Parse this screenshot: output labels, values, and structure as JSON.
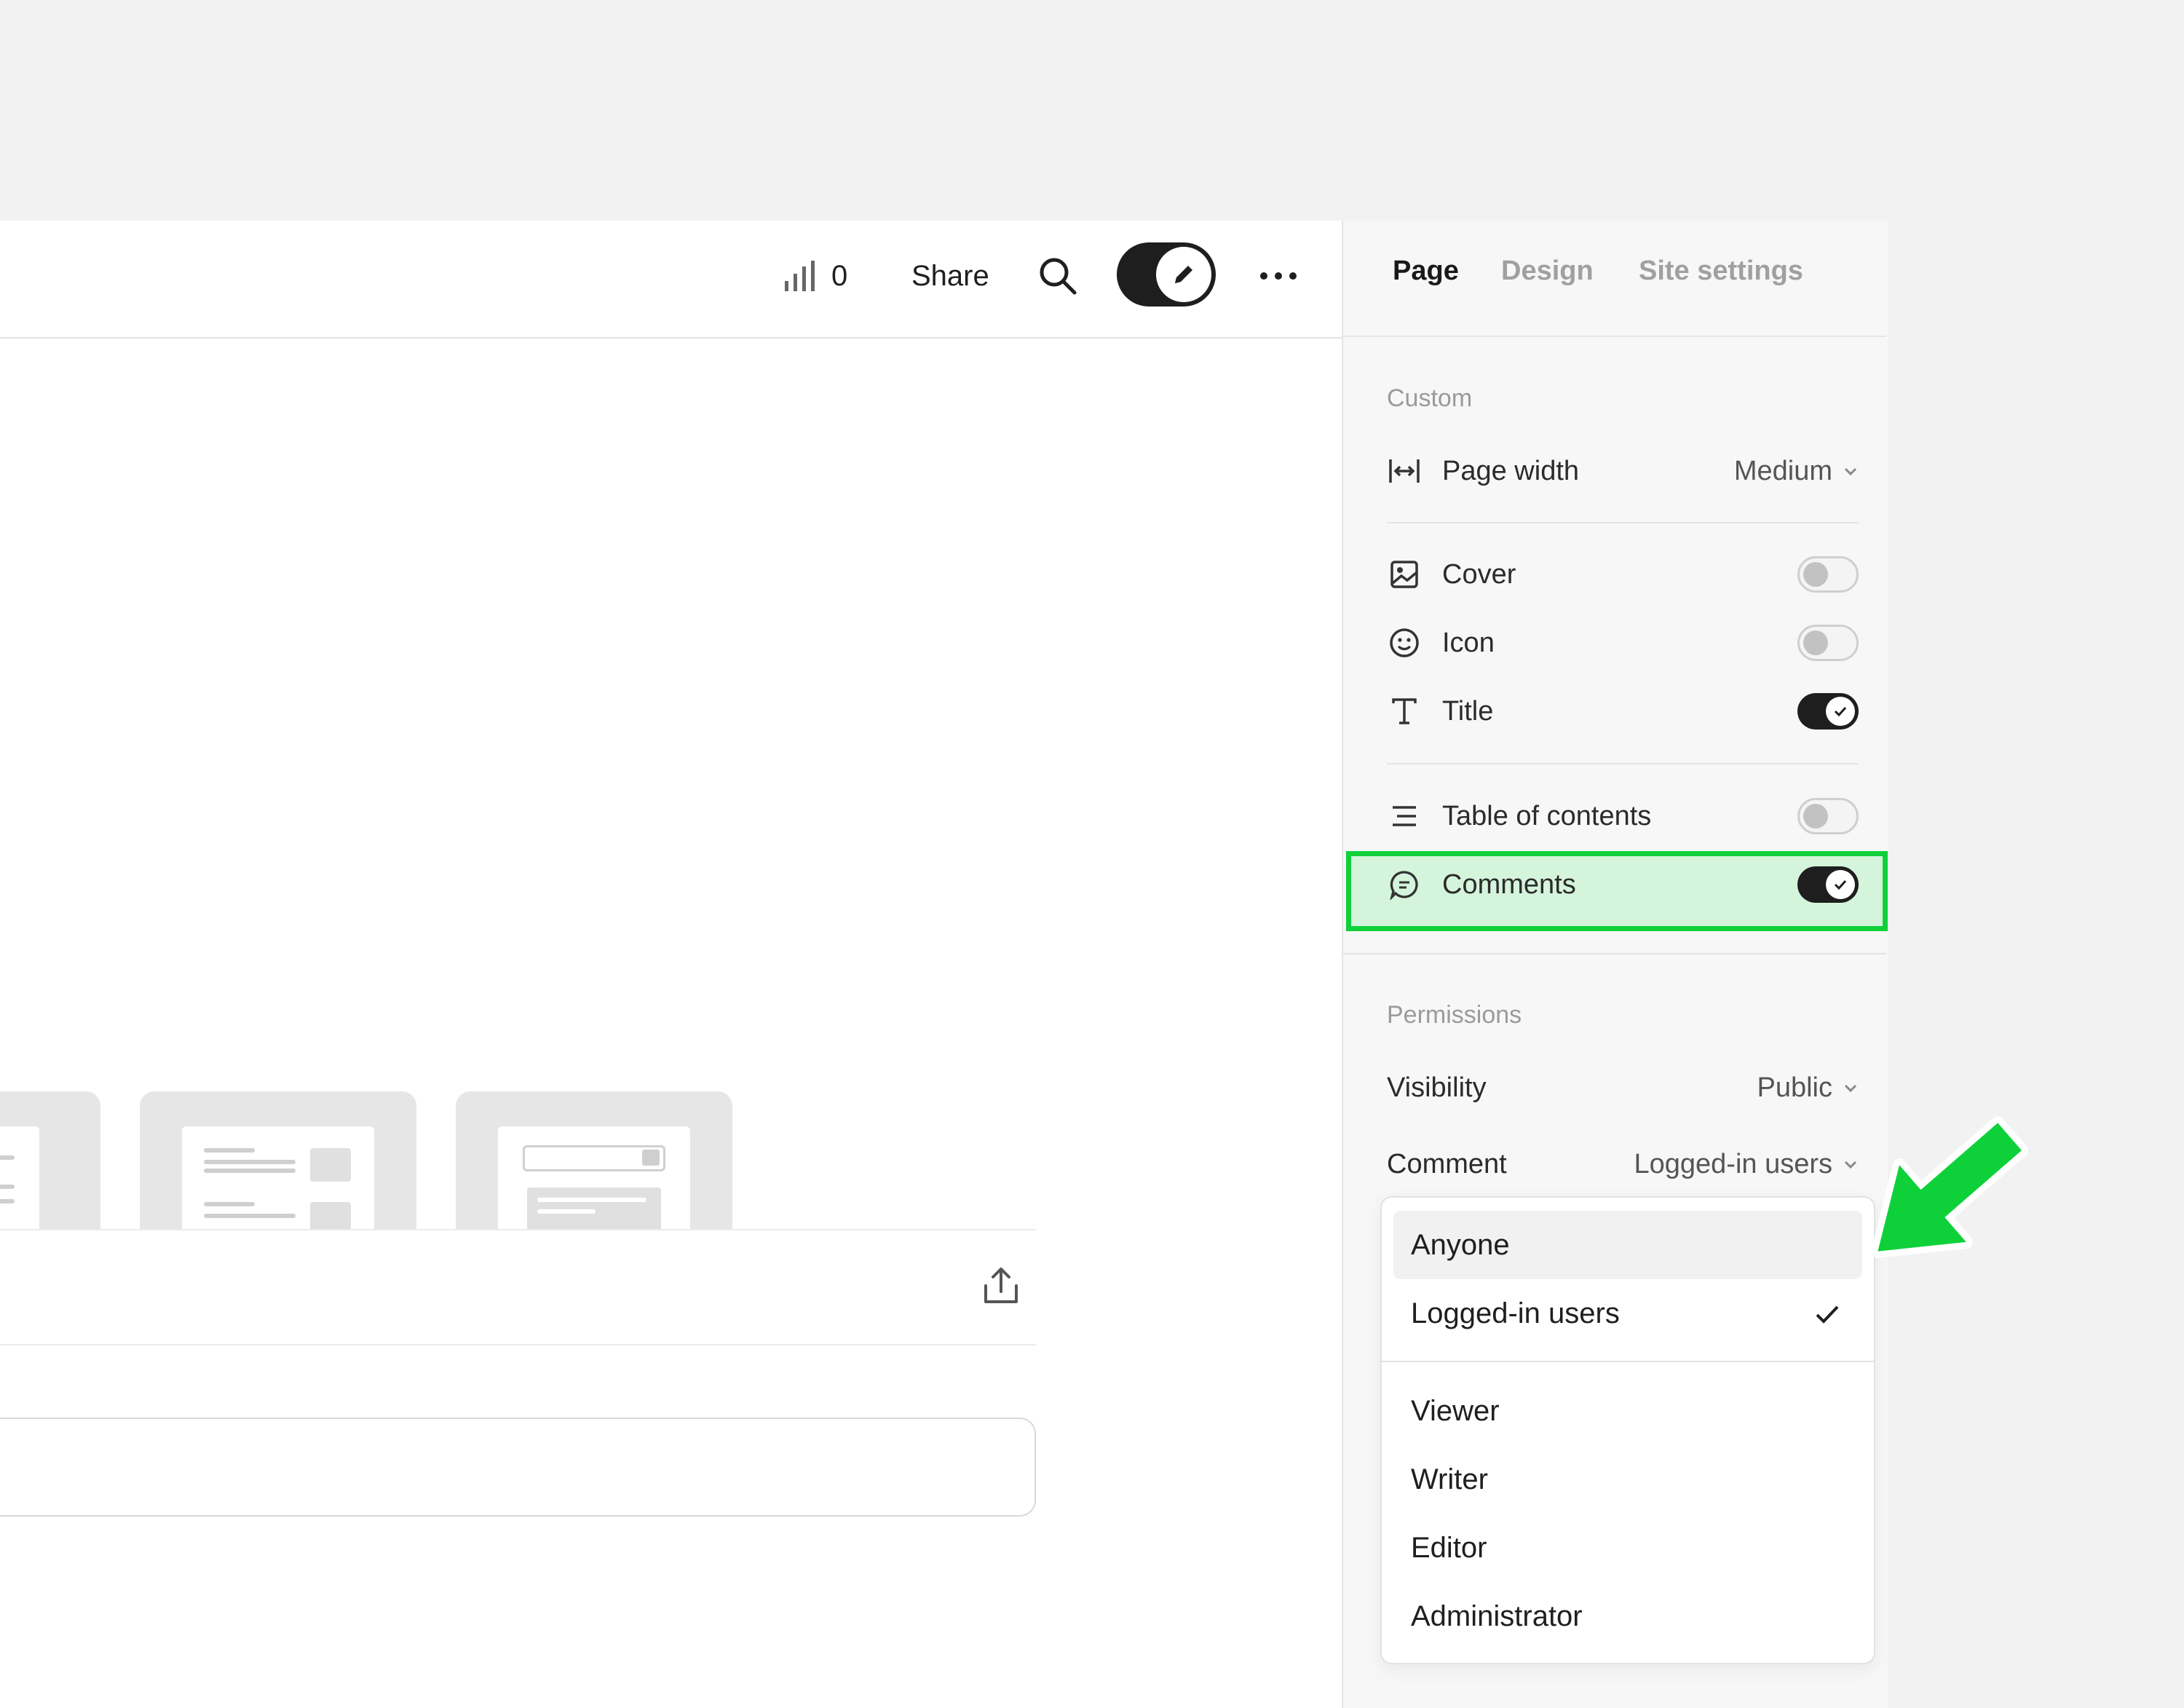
{
  "topbar": {
    "stats_count": "0",
    "share_label": "Share"
  },
  "panel": {
    "tabs": [
      {
        "label": "Page",
        "active": true
      },
      {
        "label": "Design",
        "active": false
      },
      {
        "label": "Site settings",
        "active": false
      }
    ],
    "custom": {
      "section_label": "Custom",
      "page_width": {
        "label": "Page width",
        "value": "Medium"
      },
      "toggles": [
        {
          "label": "Cover",
          "on": false,
          "icon": "image-icon"
        },
        {
          "label": "Icon",
          "on": false,
          "icon": "smiley-icon"
        },
        {
          "label": "Title",
          "on": true,
          "icon": "text-icon"
        },
        {
          "label": "Table of contents",
          "on": false,
          "icon": "list-icon"
        },
        {
          "label": "Comments",
          "on": true,
          "icon": "comment-icon"
        }
      ]
    },
    "permissions": {
      "section_label": "Permissions",
      "visibility": {
        "label": "Visibility",
        "value": "Public"
      },
      "comment": {
        "label": "Comment",
        "value": "Logged-in users"
      }
    }
  },
  "dropdown": {
    "options": [
      {
        "label": "Anyone",
        "hovered": true,
        "selected": false
      },
      {
        "label": "Logged-in users",
        "hovered": false,
        "selected": true
      },
      {
        "label": "Viewer",
        "hovered": false,
        "selected": false
      },
      {
        "label": "Writer",
        "hovered": false,
        "selected": false
      },
      {
        "label": "Editor",
        "hovered": false,
        "selected": false
      },
      {
        "label": "Administrator",
        "hovered": false,
        "selected": false
      }
    ]
  },
  "colors": {
    "highlight": "#0ed13a",
    "toggle_on": "#1e1e1e",
    "toggle_off": "#c2c2c2"
  }
}
